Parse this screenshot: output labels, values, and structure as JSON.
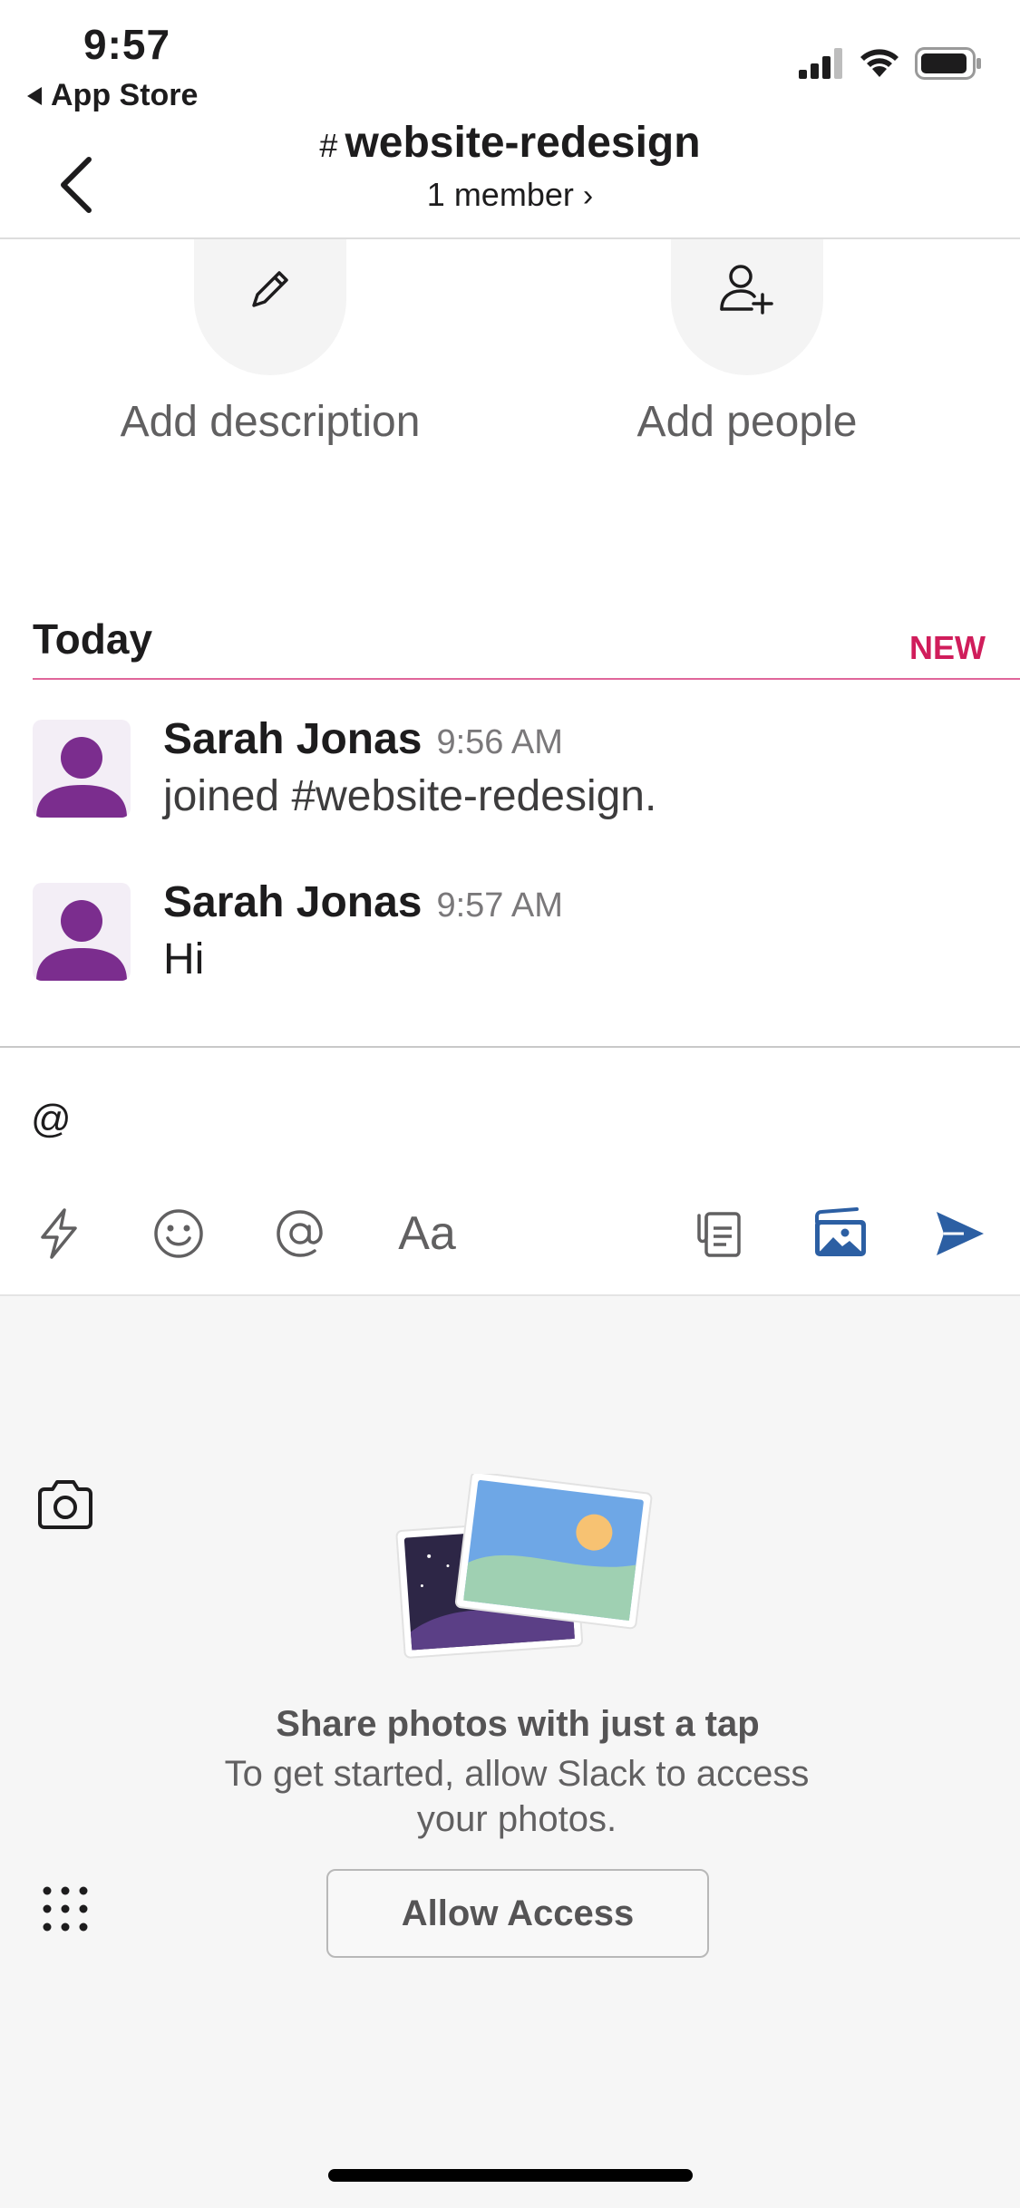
{
  "status_bar": {
    "time": "9:57",
    "back_app": "App Store"
  },
  "header": {
    "hash": "#",
    "channel_name": "website-redesign",
    "member_count": "1 member",
    "member_chevron": "›"
  },
  "actions": {
    "add_description": "Add description",
    "add_people": "Add people"
  },
  "divider": {
    "today": "Today",
    "new": "NEW"
  },
  "messages": [
    {
      "author": "Sarah Jonas",
      "time": "9:56 AM",
      "text": "joined #website-redesign."
    },
    {
      "author": "Sarah Jonas",
      "time": "9:57 AM",
      "text": "Hi"
    }
  ],
  "composer": {
    "value": "@",
    "font_button": "Aa"
  },
  "photo_panel": {
    "title": "Share photos with just a tap",
    "subtitle": "To get started, allow Slack to access your photos.",
    "allow_button": "Allow Access"
  },
  "colors": {
    "new_accent": "#d01d5b",
    "avatar_purple": "#7b2d8e",
    "send_blue": "#2c5fa3"
  },
  "icons": {
    "status": [
      "signal-icon",
      "wifi-icon",
      "battery-icon"
    ],
    "toolbar": [
      "shortcuts-icon",
      "emoji-icon",
      "mention-icon",
      "format-text-icon",
      "attachment-icon",
      "photo-library-icon",
      "send-icon"
    ],
    "panel": [
      "camera-icon",
      "grid-icon"
    ]
  }
}
